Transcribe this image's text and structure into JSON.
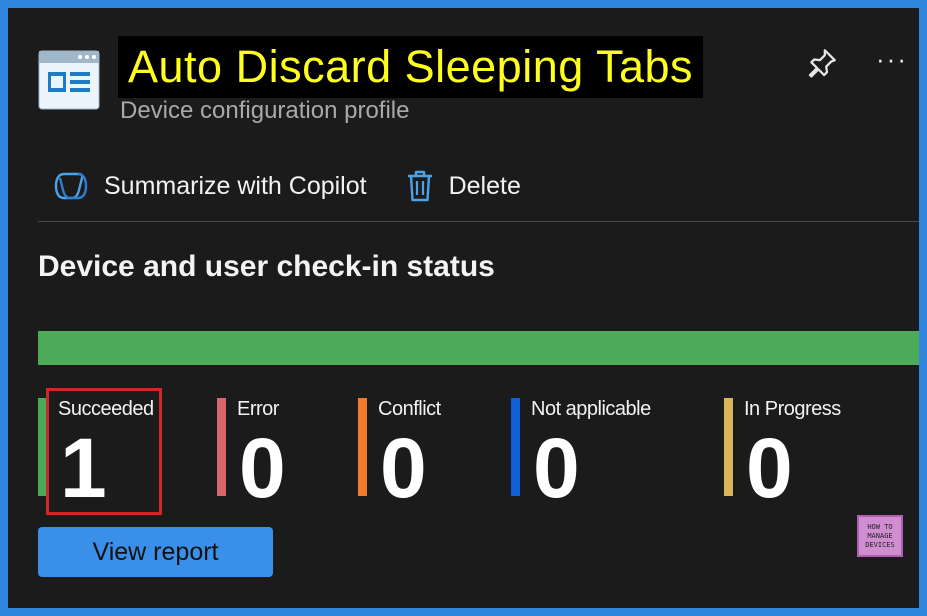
{
  "header": {
    "title": "Auto Discard Sleeping Tabs",
    "subtitle": "Device configuration profile",
    "app_icon": "settings-profile-icon",
    "pin_icon": "pin-icon",
    "more_label": "···"
  },
  "toolbar": {
    "copilot_label": "Summarize with Copilot",
    "copilot_icon": "copilot-icon",
    "delete_label": "Delete",
    "delete_icon": "trash-icon"
  },
  "section": {
    "title": "Device and user check-in status",
    "bar_color": "#4caa59",
    "bar_fill_fraction": 1.0
  },
  "stats": [
    {
      "label": "Succeeded",
      "value": "1",
      "color": "#4caa59"
    },
    {
      "label": "Error",
      "value": "0",
      "color": "#d9666b"
    },
    {
      "label": "Conflict",
      "value": "0",
      "color": "#ef7c2b"
    },
    {
      "label": "Not applicable",
      "value": "0",
      "color": "#0f5fd6"
    },
    {
      "label": "In Progress",
      "value": "0",
      "color": "#d9b65a"
    }
  ],
  "actions": {
    "view_report_label": "View report"
  },
  "watermark": {
    "line1": "HOW TO",
    "line2": "MANAGE",
    "line3": "DEVICES"
  },
  "colors": {
    "title_highlight": "#ffff1e",
    "accent": "#3a8fe8",
    "highlight_border": "#cc2929"
  }
}
